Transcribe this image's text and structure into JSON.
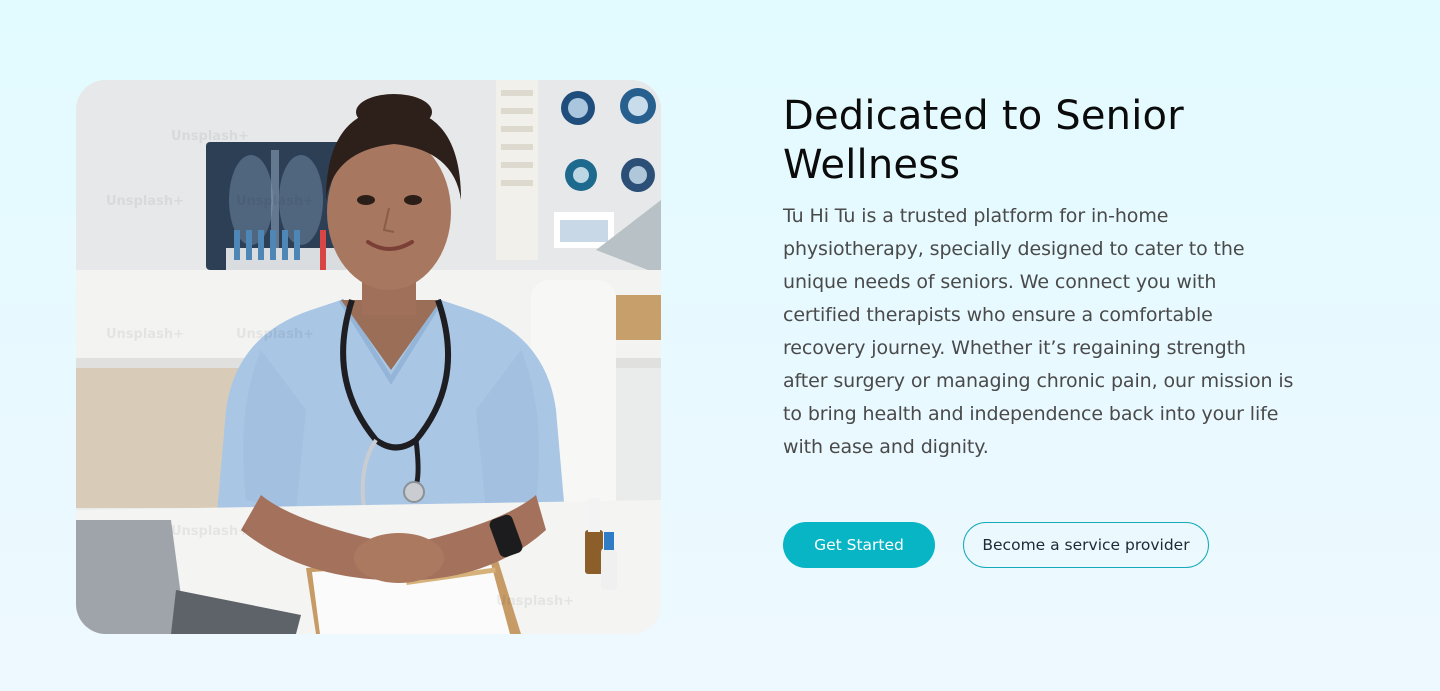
{
  "about": {
    "heading": "Dedicated to Senior Wellness",
    "description": "Tu Hi Tu is a trusted platform for in-home physiotherapy, specially designed to cater to the unique needs of seniors. We connect you with certified therapists who ensure a comfortable recovery journey. Whether it’s regaining strength after surgery or managing chronic pain, our mission is to bring health and independence back into your life with ease and dignity.",
    "image_watermark": "Unsplash+"
  },
  "actions": {
    "primary_label": "Get Started",
    "secondary_label": "Become a service provider"
  },
  "colors": {
    "background": "#e2fbff",
    "accent": "#08b5c4",
    "heading": "#0b0b0b",
    "body_text": "#4a4a4a"
  }
}
